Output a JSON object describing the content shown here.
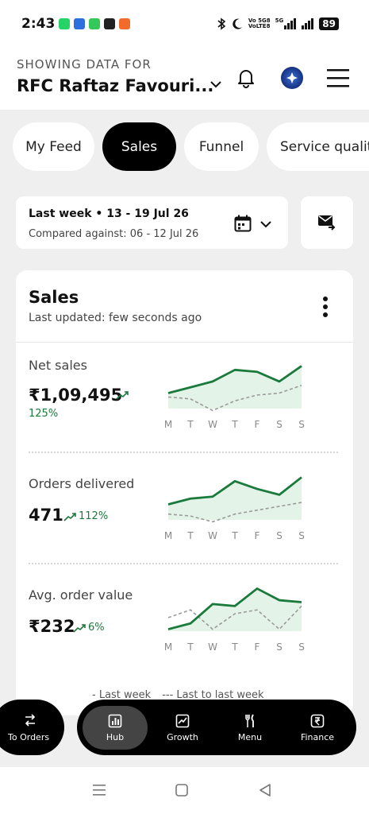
{
  "status_bar": {
    "time": "2:43",
    "network_1": "Vo 5G8",
    "network_1b": "VoLTE8",
    "network_2": "5G",
    "battery": "89"
  },
  "header": {
    "showing_label": "SHOWING DATA FOR",
    "outlet_name": "RFC Raftaz Favouri..."
  },
  "tabs": [
    {
      "label": "My Feed",
      "active": false
    },
    {
      "label": "Sales",
      "active": true
    },
    {
      "label": "Funnel",
      "active": false
    },
    {
      "label": "Service qualit",
      "active": false
    }
  ],
  "date_filter": {
    "range": "Last week • 13 - 19 Jul 26",
    "compare": "Compared against: 06 - 12 Jul 26"
  },
  "sales_card": {
    "title": "Sales",
    "updated": "Last updated: few seconds ago",
    "days": [
      "M",
      "T",
      "W",
      "T",
      "F",
      "S",
      "S"
    ],
    "metrics": [
      {
        "label": "Net sales",
        "value": "₹1,09,495",
        "delta": "125%",
        "this_week": [
          0.4,
          0.55,
          0.7,
          1.0,
          0.95,
          0.7,
          1.1
        ],
        "last_week": [
          0.3,
          0.25,
          -0.05,
          0.2,
          0.35,
          0.4,
          0.6
        ]
      },
      {
        "label": "Orders delivered",
        "value": "471",
        "delta": "112%",
        "this_week": [
          0.4,
          0.55,
          0.6,
          1.0,
          0.8,
          0.65,
          1.1
        ],
        "last_week": [
          0.15,
          0.1,
          -0.05,
          0.15,
          0.25,
          0.35,
          0.45
        ]
      },
      {
        "label": "Avg. order value",
        "value": "₹232",
        "delta": "6%",
        "this_week": [
          0.05,
          0.2,
          0.7,
          0.65,
          1.1,
          0.8,
          0.75
        ],
        "last_week": [
          0.35,
          0.55,
          0.05,
          0.45,
          0.55,
          0.05,
          0.65
        ]
      }
    ],
    "legend_this": "- Last week",
    "legend_last": "--- Last to last week"
  },
  "bottom_nav": {
    "to_orders": "To Orders",
    "items": [
      {
        "label": "Hub",
        "icon": "chart-box-icon",
        "active": true
      },
      {
        "label": "Growth",
        "icon": "growth-chart-icon",
        "active": false
      },
      {
        "label": "Menu",
        "icon": "fork-knife-icon",
        "active": false
      },
      {
        "label": "Finance",
        "icon": "rupee-icon",
        "active": false
      }
    ]
  },
  "colors": {
    "accent_green": "#1a7a3c",
    "active_tab": "#000000",
    "page_bg": "#efefef"
  }
}
